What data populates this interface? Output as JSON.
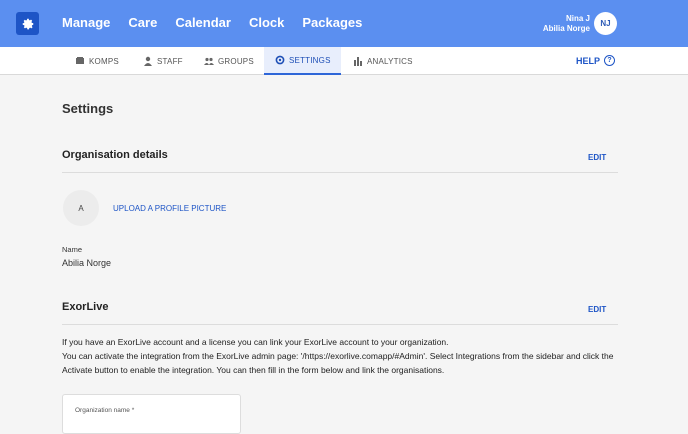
{
  "app": {
    "nav": [
      "Manage",
      "Care",
      "Calendar",
      "Clock",
      "Packages"
    ],
    "user_name": "Nina J",
    "org_name": "Abilia Norge",
    "avatar_initials": "NJ"
  },
  "subnav": {
    "tabs": [
      {
        "label": "KOMPS",
        "icon": "komps-icon"
      },
      {
        "label": "STAFF",
        "icon": "staff-icon"
      },
      {
        "label": "GROUPS",
        "icon": "groups-icon"
      },
      {
        "label": "SETTINGS",
        "icon": "gear-icon"
      },
      {
        "label": "ANALYTICS",
        "icon": "analytics-icon"
      }
    ],
    "active_tab": "SETTINGS",
    "help_label": "HELP",
    "help_icon": "?"
  },
  "page": {
    "title": "Settings",
    "org_section": {
      "heading": "Organisation details",
      "edit_label": "EDIT",
      "avatar_letter": "A",
      "upload_label": "UPLOAD A PROFILE PICTURE",
      "name_label": "Name",
      "name_value": "Abilia Norge"
    },
    "exorlive_section": {
      "heading": "ExorLive",
      "edit_label": "EDIT",
      "text_line1": "If you have an ExorLive account and a license you can link your ExorLive account to your organization.",
      "text_line2": "You can activate the integration from the ExorLive admin page: '/https://exorlive.comapp/#Admin'. Select Integrations from the sidebar and click the Activate button to enable the integration. You can then fill in the form below and link the organisations.",
      "org_name_label": "Organization name *"
    }
  },
  "colors": {
    "topbar": "#5b8ff0",
    "accent": "#1e55c6"
  }
}
